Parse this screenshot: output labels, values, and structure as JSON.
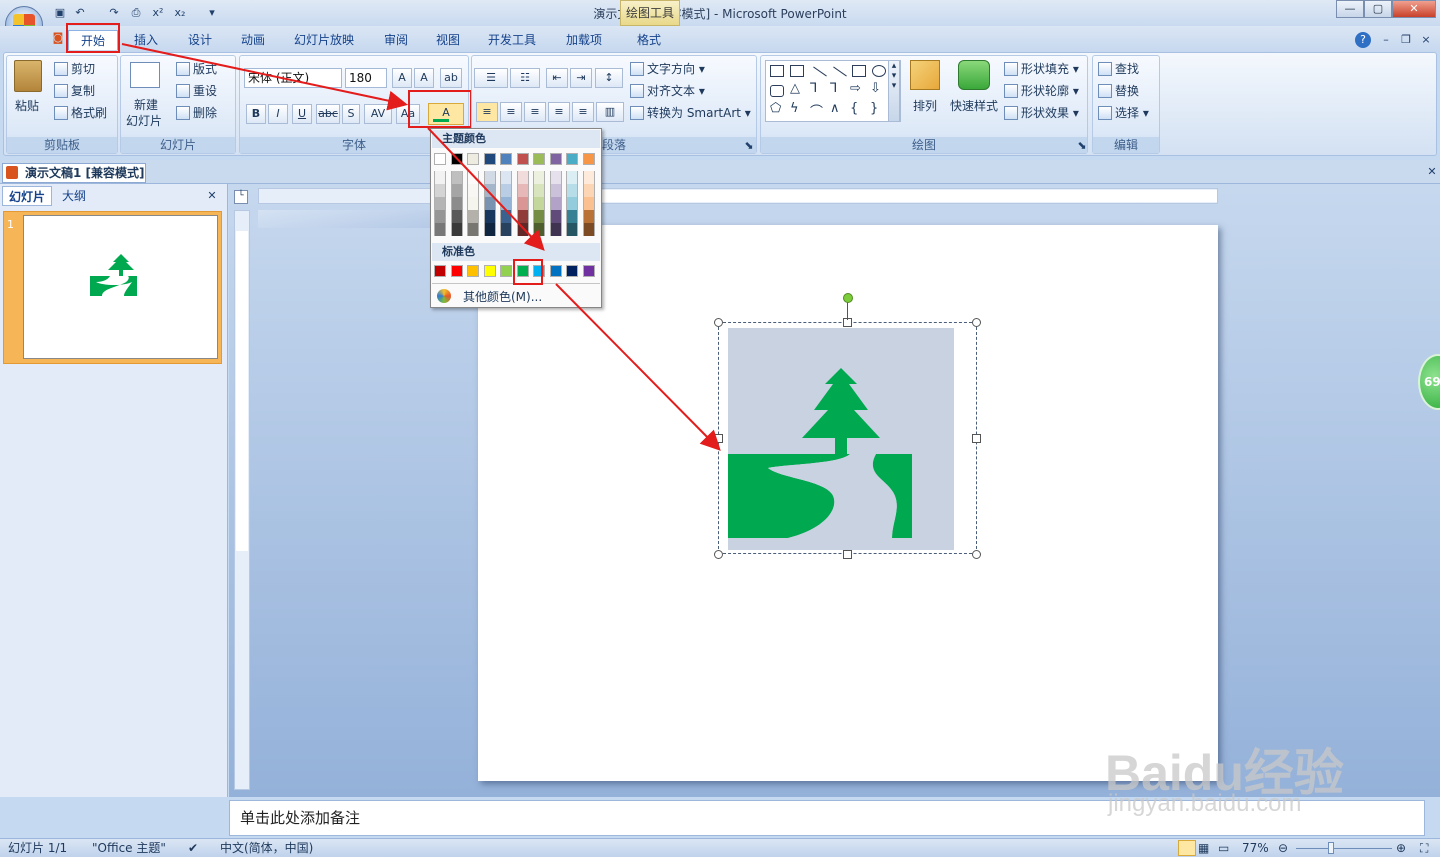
{
  "window": {
    "title": "演示文稿1 [兼容模式] - Microsoft PowerPoint",
    "context_tab_title": "绘图工具",
    "buttons": [
      "—",
      "▢",
      "✕"
    ]
  },
  "tabs": [
    "开始",
    "插入",
    "设计",
    "动画",
    "幻灯片放映",
    "审阅",
    "视图",
    "开发工具",
    "加载项",
    "格式"
  ],
  "ribbon": {
    "clipboard": {
      "label": "剪贴板",
      "paste": "粘贴",
      "cut": "剪切",
      "copy": "复制",
      "format_painter": "格式刷"
    },
    "slides": {
      "label": "幻灯片",
      "new_slide_1": "新建",
      "new_slide_2": "幻灯片",
      "layout": "版式",
      "reset": "重设",
      "delete": "删除"
    },
    "font": {
      "label": "字体",
      "font_name": "宋体 (正文)",
      "font_size": "180"
    },
    "paragraph": {
      "label": "段落",
      "text_direction": "文字方向",
      "align_text": "对齐文本",
      "smartart": "转换为 SmartArt"
    },
    "drawing": {
      "label": "绘图",
      "arrange": "排列",
      "quick_styles": "快速样式",
      "shape_fill": "形状填充",
      "shape_outline": "形状轮廓",
      "shape_effects": "形状效果"
    },
    "editing": {
      "label": "编辑",
      "find": "查找",
      "replace": "替换",
      "select": "选择"
    }
  },
  "color_picker": {
    "theme_header": "主题颜色",
    "standard_header": "标准色",
    "more_colors": "其他颜色(M)...",
    "theme_top": [
      "#ffffff",
      "#000000",
      "#eeece1",
      "#1f497d",
      "#4f81bd",
      "#c0504d",
      "#9bbb59",
      "#8064a2",
      "#4bacc6",
      "#f79646"
    ],
    "standard": [
      "#c00000",
      "#ff0000",
      "#ffc000",
      "#ffff00",
      "#92d050",
      "#00b050",
      "#00b0f0",
      "#0070c0",
      "#002060",
      "#7030a0"
    ]
  },
  "doc_tab": "演示文稿1 [兼容模式]",
  "left_pane": {
    "tab_slides": "幻灯片",
    "tab_outline": "大纲",
    "slide_number": "1"
  },
  "notes_placeholder": "单击此处添加备注",
  "status": {
    "slide": "幻灯片 1/1",
    "theme": "\"Office 主题\"",
    "language": "中文(简体，中国)",
    "zoom": "77%"
  },
  "badge": "69",
  "watermark": {
    "text": "Baidu经验",
    "url": "jingyan.baidu.com"
  },
  "accent_green": "#00a94f"
}
